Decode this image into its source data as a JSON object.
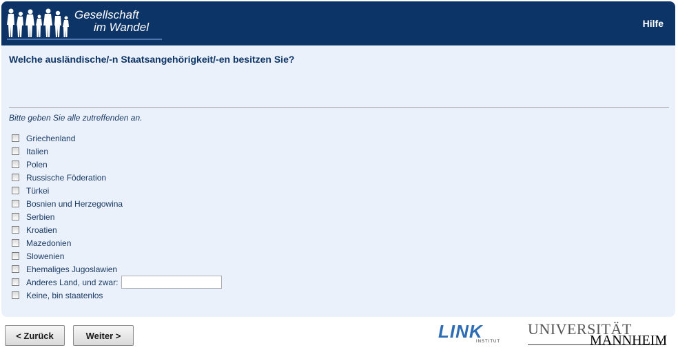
{
  "header": {
    "brand_line1": "Gesellschaft",
    "brand_line2": "im Wandel",
    "help_label": "Hilfe"
  },
  "question": {
    "title": "Welche ausländische/-n Staatsangehörigkeit/-en besitzen Sie?",
    "instruction": "Bitte geben Sie alle zutreffenden an.",
    "options": [
      {
        "label": "Griechenland",
        "checked": false
      },
      {
        "label": "Italien",
        "checked": false
      },
      {
        "label": "Polen",
        "checked": false
      },
      {
        "label": "Russische Föderation",
        "checked": false
      },
      {
        "label": "Türkei",
        "checked": false
      },
      {
        "label": "Bosnien und Herzegowina",
        "checked": false
      },
      {
        "label": "Serbien",
        "checked": false
      },
      {
        "label": "Kroatien",
        "checked": false
      },
      {
        "label": "Mazedonien",
        "checked": false
      },
      {
        "label": "Slowenien",
        "checked": false
      },
      {
        "label": "Ehemaliges Jugoslawien",
        "checked": false
      },
      {
        "label": "Anderes Land, und zwar:",
        "checked": false,
        "text_value": ""
      },
      {
        "label": "Keine, bin staatenlos",
        "checked": false
      }
    ]
  },
  "nav": {
    "back_label": "< Zurück",
    "next_label": "Weiter >"
  },
  "footer": {
    "link_logo_word": "LINK",
    "link_logo_sub": "INSTITUT",
    "uni_logo_line1": "UNIVERSITÄT",
    "uni_logo_line2": "MANNHEIM"
  },
  "colors": {
    "header_bg": "#0d3466",
    "card_bg": "#eaf1fa",
    "text": "#0d3466",
    "link_blue": "#2d6db5"
  }
}
